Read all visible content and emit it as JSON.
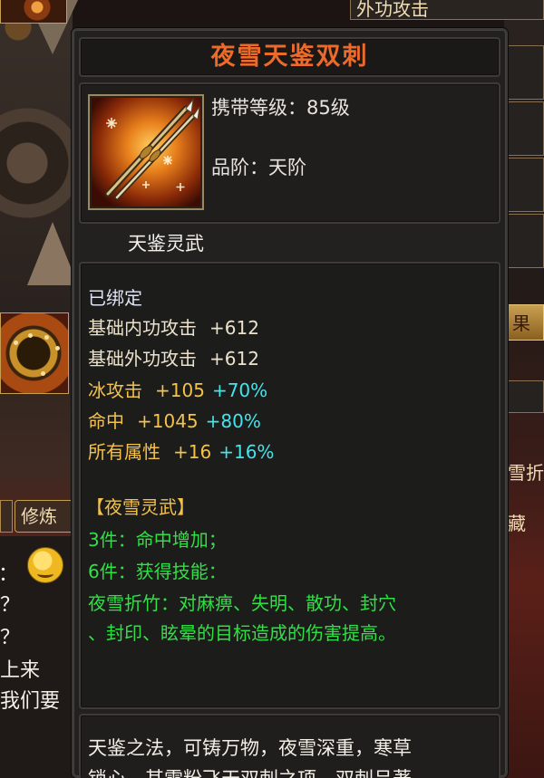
{
  "background": {
    "top_strip": "外功攻击",
    "left_button": "修炼",
    "right_tabs": [
      "果",
      "雪折",
      "藏"
    ],
    "chat_lines": [
      "：",
      "？",
      "？",
      "上来",
      "我们要"
    ]
  },
  "tooltip": {
    "title": "夜雪天鉴双刺",
    "icon": "twin-spear-weapon-icon",
    "carry_level": "携带等级：85级",
    "grade": "品阶：天阶",
    "subtitle": "天鉴灵武",
    "bound": "已绑定",
    "base_stats": [
      {
        "name": "基础内功攻击",
        "value": "+612"
      },
      {
        "name": "基础外功攻击",
        "value": "+612"
      }
    ],
    "bonus_stats": [
      {
        "name": "冰攻击",
        "value": "+105",
        "pct": "+70%"
      },
      {
        "name": "命中",
        "value": "+1045",
        "pct": "+80%"
      },
      {
        "name": "所有属性",
        "value": "+16",
        "pct": "+16%"
      }
    ],
    "set_name": "【夜雪灵武】",
    "set_bonus": [
      "3件：命中增加；",
      "6件：获得技能：",
      "夜雪折竹：对麻痹、失明、散功、封穴",
      "、封印、眩晕的目标造成的伤害提高。"
    ],
    "description": [
      "天鉴之法，可铸万物，夜雪深重，寒草",
      "锁心，其雪粉飞天双刺之项，双刺吕著"
    ],
    "colors": {
      "title": "#ec6a2a",
      "bonus": "#f4c24a",
      "percent": "#44e4ec",
      "set": "#34e64a"
    }
  }
}
